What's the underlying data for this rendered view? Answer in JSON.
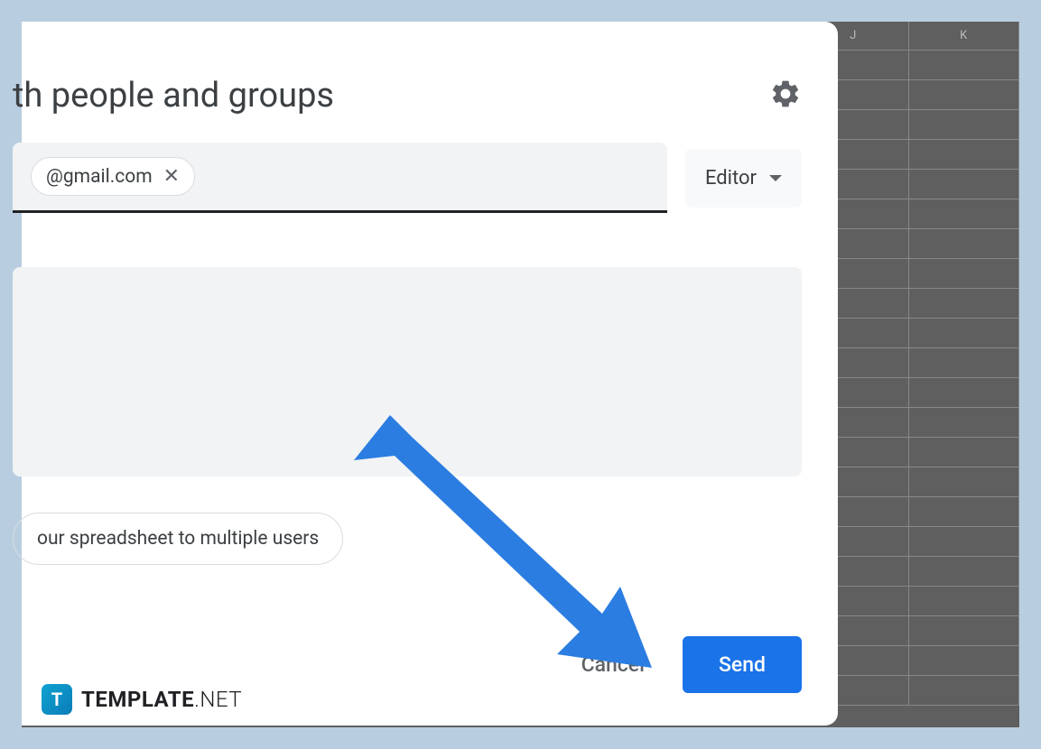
{
  "dialog": {
    "title": "th people and groups"
  },
  "recipient": {
    "email": "@gmail.com",
    "remove_glyph": "✕"
  },
  "role": {
    "label": "Editor"
  },
  "notify": {
    "text": "our spreadsheet to multiple users"
  },
  "actions": {
    "cancel": "Cancel",
    "send": "Send"
  },
  "spreadsheet": {
    "columns": [
      "J",
      "K"
    ]
  },
  "watermark": {
    "icon_letter": "T",
    "brand_bold": "TEMPLATE",
    "brand_light": ".NET"
  }
}
